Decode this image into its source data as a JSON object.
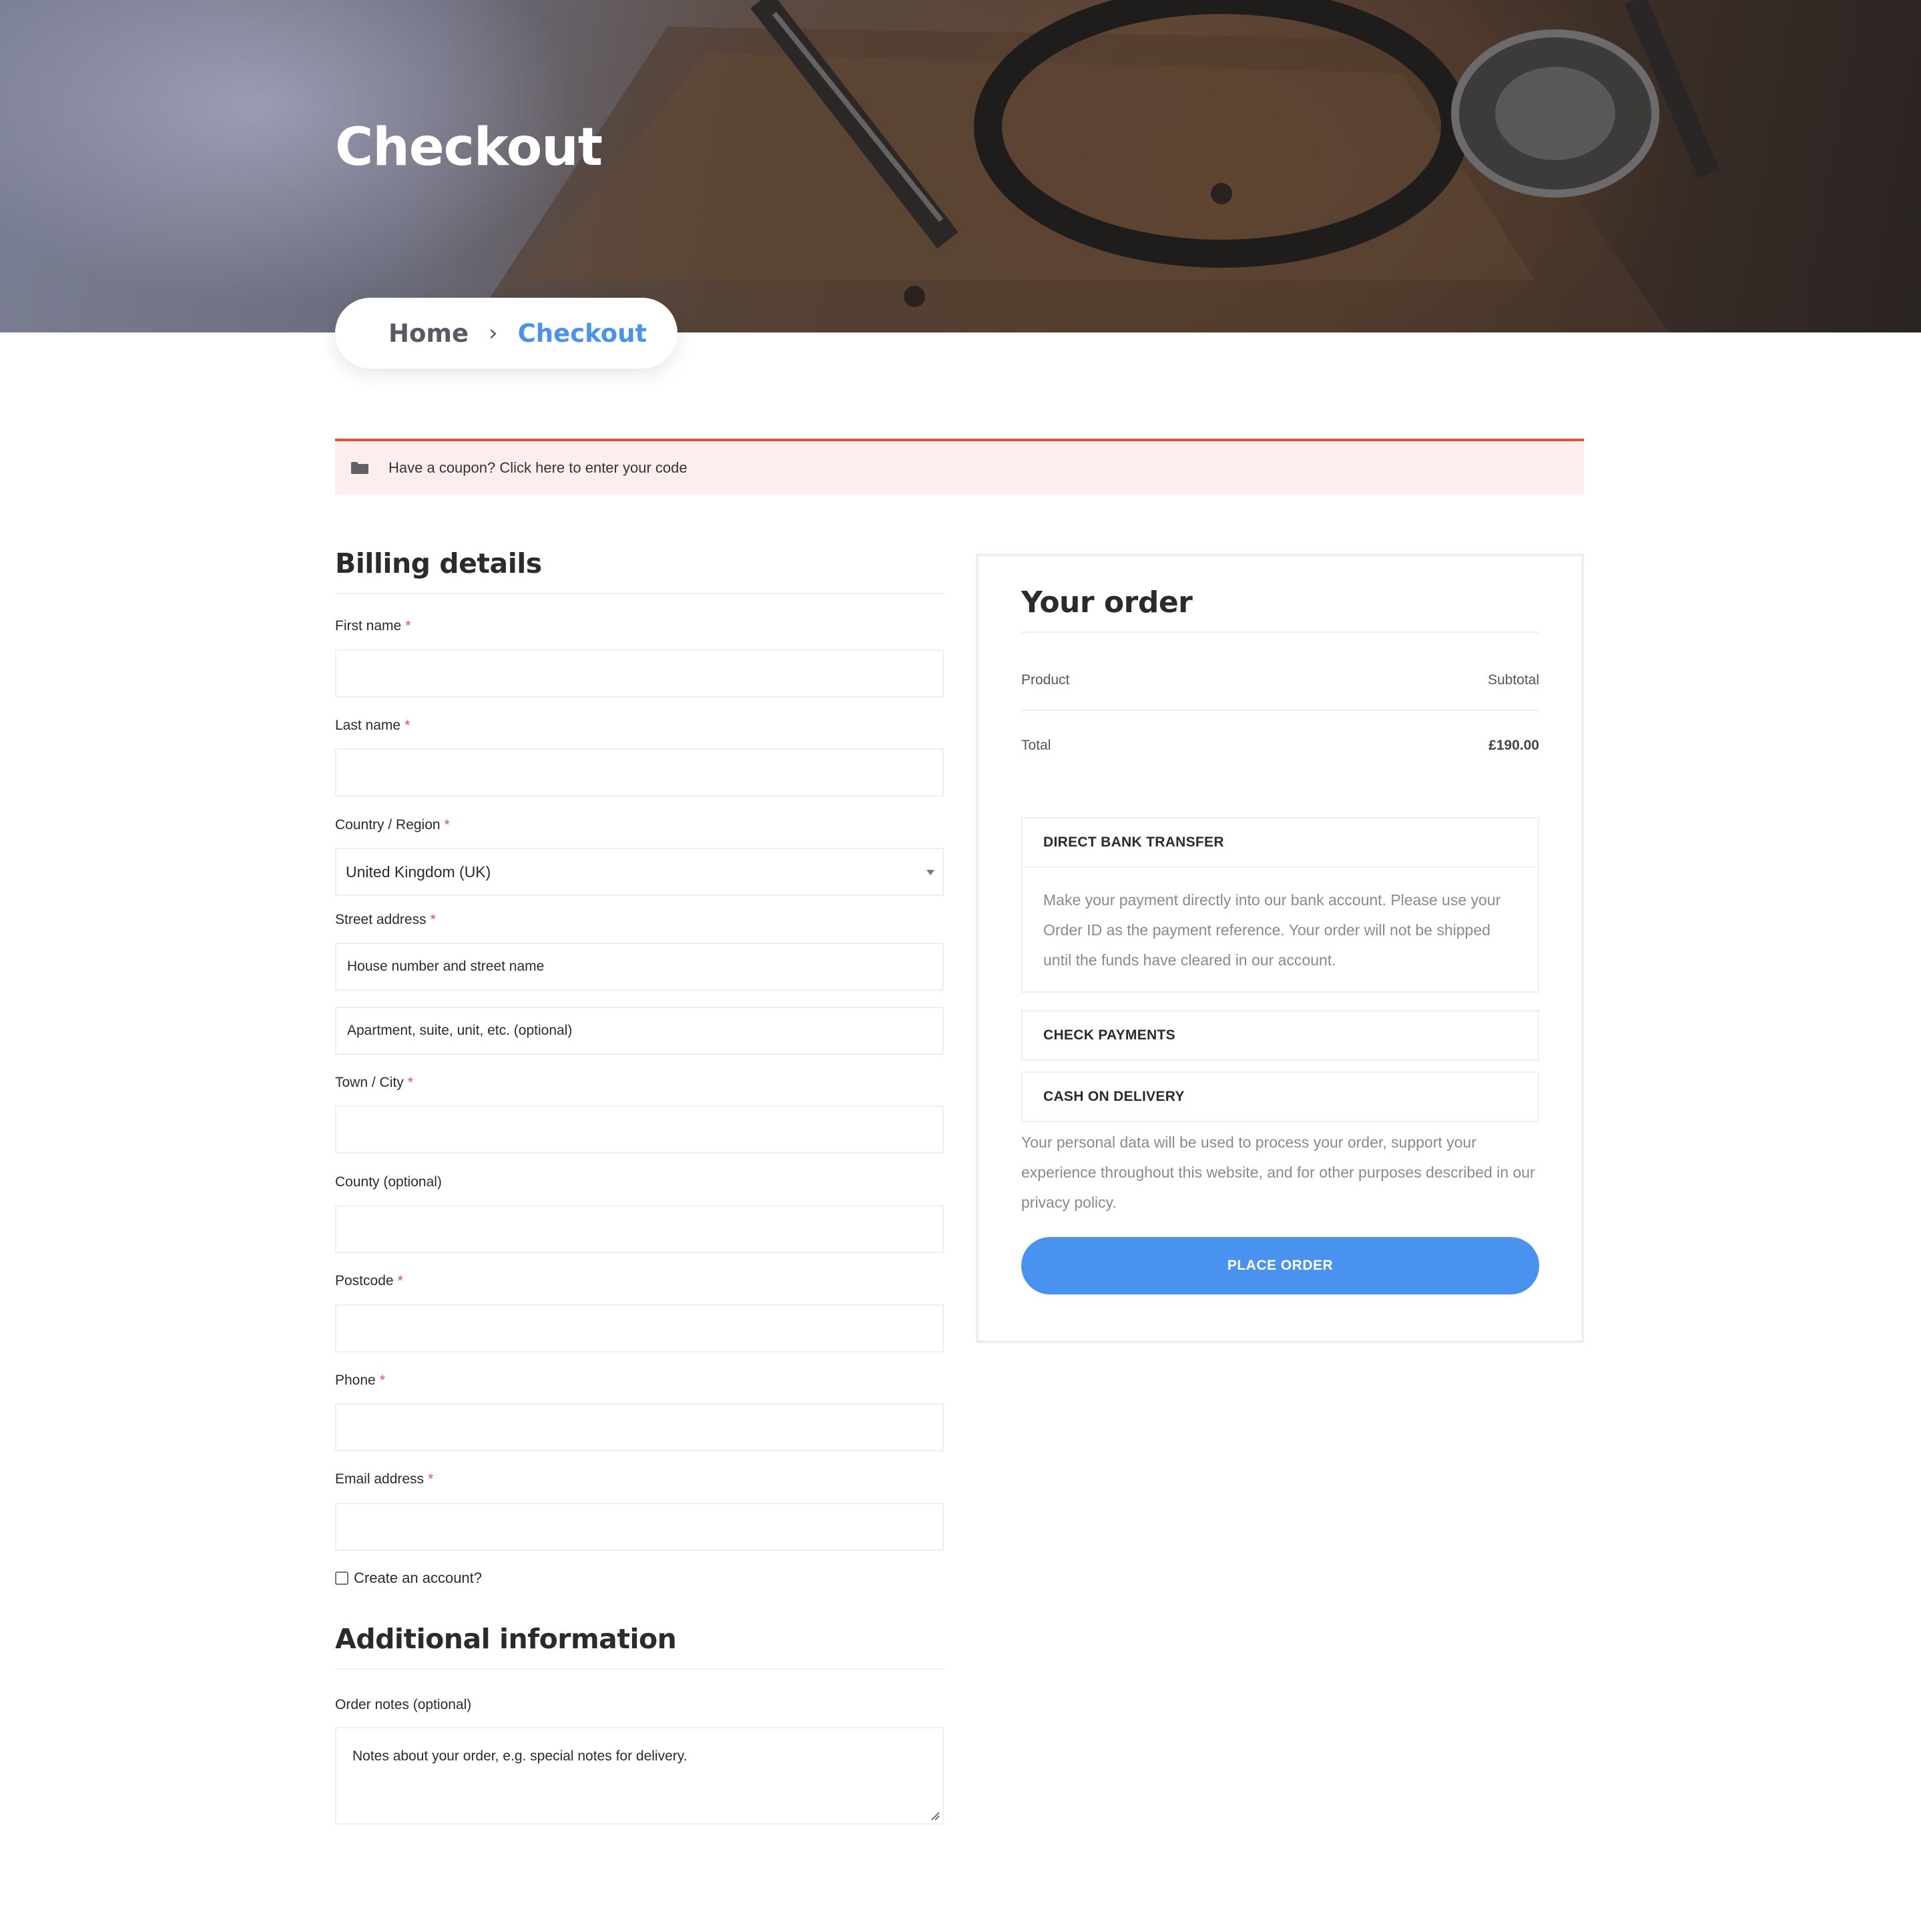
{
  "hero": {
    "title": "Checkout"
  },
  "breadcrumb": {
    "home": "Home",
    "separator": "›",
    "current": "Checkout"
  },
  "coupon": {
    "icon": "folder-icon",
    "text": "Have a coupon? Click here to enter your code"
  },
  "billing": {
    "title": "Billing details",
    "required_mark": "*",
    "first_name_label": "First name",
    "last_name_label": "Last name",
    "country_label": "Country / Region",
    "country_value": "United Kingdom (UK)",
    "street_label": "Street address",
    "street_placeholder": "House number and street name",
    "street2_placeholder": "Apartment, suite, unit, etc. (optional)",
    "city_label": "Town / City",
    "county_label": "County (optional)",
    "postcode_label": "Postcode",
    "phone_label": "Phone",
    "email_label": "Email address",
    "create_account_label": "Create an account?"
  },
  "additional": {
    "title": "Additional information",
    "notes_label": "Order notes (optional)",
    "notes_placeholder": "Notes about your order, e.g. special notes for delivery."
  },
  "order": {
    "title": "Your order",
    "product_header": "Product",
    "subtotal_header": "Subtotal",
    "total_label": "Total",
    "total_value": "£190.00",
    "payments": {
      "bank": {
        "title": "DIRECT BANK TRANSFER",
        "description": "Make your payment directly into our bank account. Please use your Order ID as the payment reference. Your order will not be shipped until the funds have cleared in our account."
      },
      "check": {
        "title": "CHECK PAYMENTS"
      },
      "cod": {
        "title": "CASH ON DELIVERY"
      }
    },
    "privacy_text": "Your personal data will be used to process your order, support your experience throughout this website, and for other purposes described in our privacy policy.",
    "place_order_label": "PLACE ORDER"
  },
  "colors": {
    "accent": "#4a92f0",
    "notice_border": "#e0533a",
    "notice_bg": "#fdeeee",
    "required": "#e0533a"
  }
}
